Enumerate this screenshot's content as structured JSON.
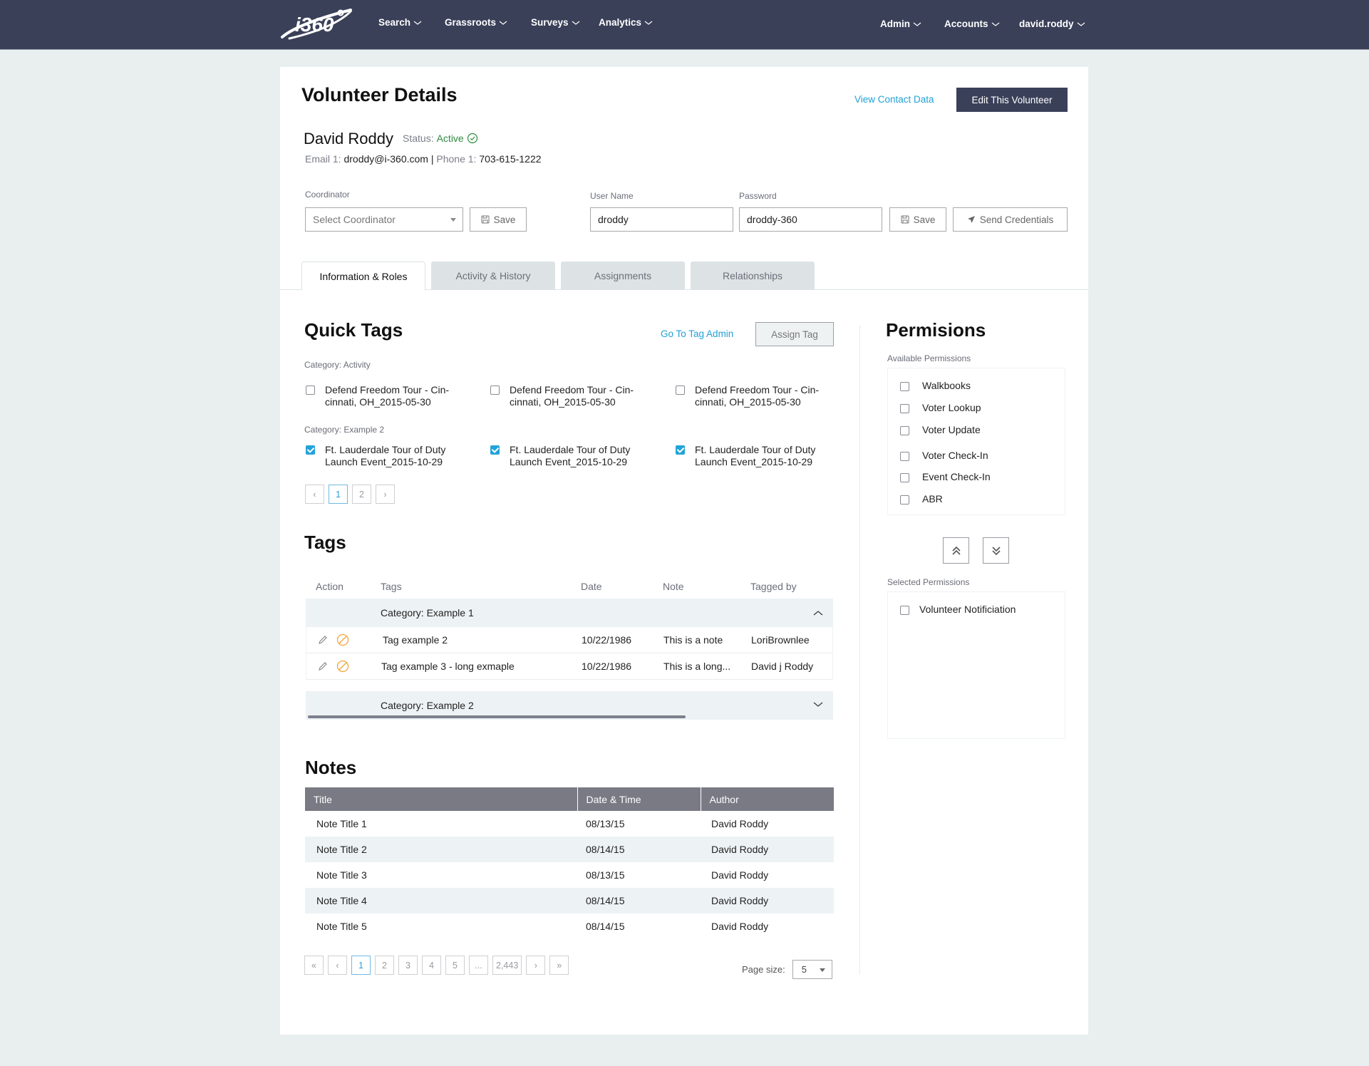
{
  "nav": {
    "logo_text": "i360",
    "left_items": [
      "Search",
      "Grassroots",
      "Surveys",
      "Analytics"
    ],
    "right_items": [
      "Admin",
      "Accounts",
      "david.roddy"
    ]
  },
  "header": {
    "title": "Volunteer Details",
    "view_contact_link": "View Contact Data",
    "edit_button": "Edit This Volunteer"
  },
  "volunteer": {
    "name": "David Roddy",
    "status_label": "Status:",
    "status_value": "Active",
    "email_label": "Email 1:",
    "email": "droddy@i-360.com",
    "separator": "|",
    "phone_label": "Phone 1:",
    "phone": "703-615-1222"
  },
  "form": {
    "coordinator_label": "Coordinator",
    "coordinator_placeholder": "Select Coordinator",
    "save_label": "Save",
    "username_label": "User Name",
    "username_value": "droddy",
    "password_label": "Password",
    "password_value": "droddy-360",
    "send_credentials_label": "Send Credentials"
  },
  "tabs": [
    {
      "label": "Information & Roles",
      "active": true
    },
    {
      "label": "Activity & History",
      "active": false
    },
    {
      "label": "Assignments",
      "active": false
    },
    {
      "label": "Relationships",
      "active": false
    }
  ],
  "quick_tags": {
    "title": "Quick Tags",
    "admin_link": "Go To Tag Admin",
    "assign_button": "Assign Tag",
    "categories": [
      {
        "label": "Category: Activity",
        "items": [
          {
            "text": "Defend Freedom Tour - Cin-cinnati, OH_2015-05-30",
            "checked": false
          },
          {
            "text": "Defend Freedom Tour - Cin-cinnati, OH_2015-05-30",
            "checked": false
          },
          {
            "text": "Defend Freedom Tour - Cin-cinnati, OH_2015-05-30",
            "checked": false
          }
        ]
      },
      {
        "label": "Category: Example 2",
        "items": [
          {
            "text": "Ft. Lauderdale Tour of Duty Launch Event_2015-10-29",
            "checked": true
          },
          {
            "text": "Ft. Lauderdale Tour of Duty Launch Event_2015-10-29",
            "checked": true
          },
          {
            "text": "Ft. Lauderdale Tour of Duty Launch Event_2015-10-29",
            "checked": true
          }
        ]
      }
    ],
    "pager": {
      "prev": "‹",
      "pages": [
        "1",
        "2"
      ],
      "current": "1",
      "next": "›"
    }
  },
  "tags": {
    "title": "Tags",
    "columns": [
      "Action",
      "Tags",
      "Date",
      "Note",
      "Tagged by"
    ],
    "groups": [
      {
        "label": "Category: Example 1",
        "expanded": true,
        "rows": [
          {
            "tag": "Tag example 2",
            "date": "10/22/1986",
            "note": "This is a note",
            "tagged_by": "LoriBrownlee"
          },
          {
            "tag": "Tag example 3 - long exmaple",
            "date": "10/22/1986",
            "note": "This is a long...",
            "tagged_by": "David j Roddy"
          }
        ]
      },
      {
        "label": "Category: Example 2",
        "expanded": false,
        "rows": []
      }
    ]
  },
  "notes": {
    "title": "Notes",
    "columns": [
      "Title",
      "Date & Time",
      "Author"
    ],
    "rows": [
      {
        "title": "Note Title 1",
        "date": "08/13/15",
        "author": "David Roddy"
      },
      {
        "title": "Note Title 2",
        "date": "08/14/15",
        "author": "David Roddy"
      },
      {
        "title": "Note Title 3",
        "date": "08/13/15",
        "author": "David Roddy"
      },
      {
        "title": "Note Title 4",
        "date": "08/14/15",
        "author": "David Roddy"
      },
      {
        "title": "Note Title 5",
        "date": "08/14/15",
        "author": "David Roddy"
      }
    ],
    "pager": {
      "first": "«",
      "prev": "‹",
      "pages": [
        "1",
        "2",
        "3",
        "4",
        "5",
        "...",
        "2,443"
      ],
      "current": "1",
      "next": "›",
      "last": "»"
    },
    "page_size_label": "Page size:",
    "page_size_value": "5"
  },
  "permissions": {
    "title": "Permisions",
    "available_label": "Available Permissions",
    "available": [
      "Walkbooks",
      "Voter Lookup",
      "Voter Update",
      "Voter Check-In",
      "Event Check-In",
      "ABR"
    ],
    "selected_label": "Selected Permissions",
    "selected": [
      "Volunteer Notificiation"
    ]
  },
  "colors": {
    "nav_bg": "#3b4059",
    "accent_link": "#23a0d6",
    "status_active": "#2d8a3e",
    "checkbox_checked": "#22a3d9",
    "remove_icon": "#f4a53a",
    "table_header": "#7a7a85"
  }
}
